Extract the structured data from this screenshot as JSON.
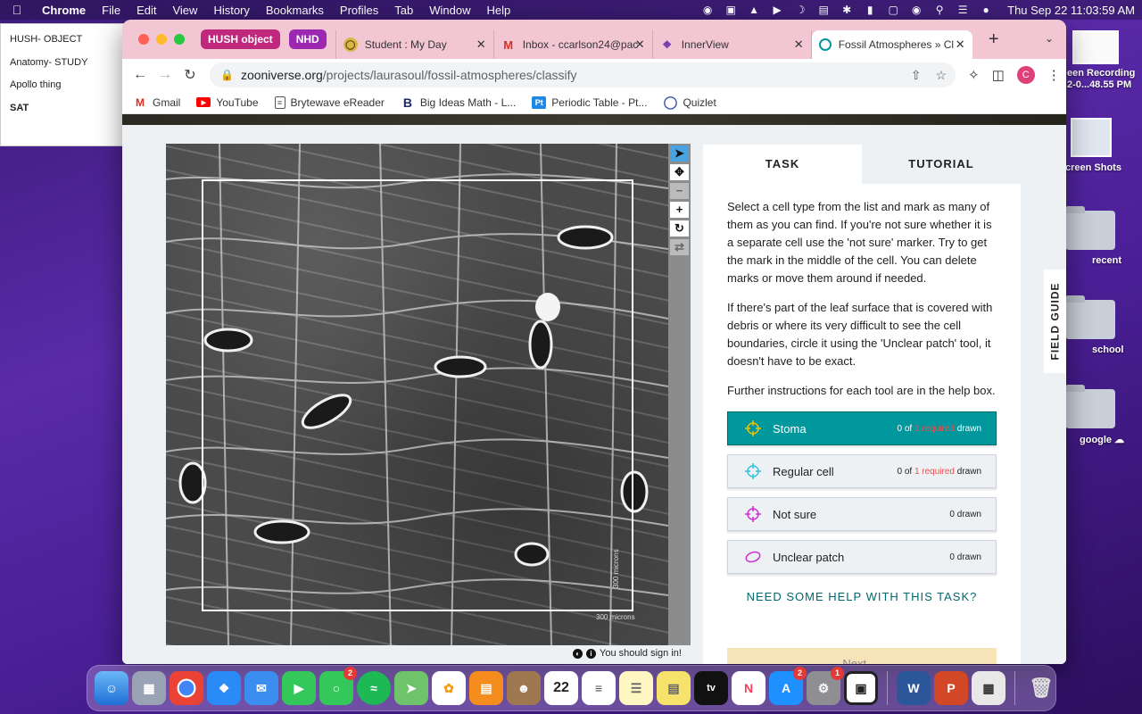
{
  "menubar": {
    "app": "Chrome",
    "items": [
      "File",
      "Edit",
      "View",
      "History",
      "Bookmarks",
      "Profiles",
      "Tab",
      "Window",
      "Help"
    ],
    "clock": "Thu Sep 22  11:03:59 AM"
  },
  "sticky": {
    "items": [
      "HUSH- OBJECT",
      "Anatomy- STUDY",
      "Apollo thing",
      "SAT"
    ]
  },
  "desktop": {
    "screen_recording": "een Recording\n2-0...48.55 PM",
    "screen_shots": "creen Shots",
    "recent": "recent",
    "school": "school",
    "google": "google"
  },
  "browser": {
    "tab_groups": [
      {
        "label": "HUSH object",
        "color": "#c0287e"
      },
      {
        "label": "NHD",
        "color": "#9c27b0"
      }
    ],
    "tabs": [
      {
        "label": "Student : My Day",
        "icon": "student-icon"
      },
      {
        "label": "Inbox - ccarlson24@pac",
        "icon": "gmail-icon"
      },
      {
        "label": "InnerView",
        "icon": "innerview-icon"
      },
      {
        "label": "Fossil Atmospheres » Cl",
        "icon": "zooniverse-icon"
      }
    ],
    "url_host": "zooniverse.org",
    "url_path": "/projects/laurasoul/fossil-atmospheres/classify",
    "avatar_letter": "C",
    "bookmarks": [
      "Gmail",
      "YouTube",
      "Brytewave eReader",
      "Big Ideas Math - L...",
      "Periodic Table - Pt...",
      "Quizlet"
    ]
  },
  "subject": {
    "scale_bottom": "300 microns",
    "scale_side": "300 microns"
  },
  "signin_text": "You should sign in!",
  "task": {
    "tab_task": "TASK",
    "tab_tutorial": "TUTORIAL",
    "paragraphs": [
      "Select a cell type from the list and mark as many of them as you can find. If you're not sure whether it is a separate cell use the 'not sure' marker. Try to get the mark in the middle of the cell. You can delete marks or move them around if needed.",
      "If there's part of the leaf surface that is covered with debris or where its very difficult to see the cell boundaries, circle it using the 'Unclear patch' tool, it doesn't have to be exact.",
      "Further instructions for each tool are in the help box."
    ],
    "tools": [
      {
        "label": "Stoma",
        "count_pre": "0 of ",
        "count_req": "1 required",
        "count_post": " drawn",
        "color": "#f2c200",
        "active": true
      },
      {
        "label": "Regular cell",
        "count_pre": "0 of ",
        "count_req": "1 required",
        "count_post": " drawn",
        "color": "#33c3e0",
        "active": false
      },
      {
        "label": "Not sure",
        "count_pre": "0 drawn",
        "count_req": "",
        "count_post": "",
        "color": "#d22fd2",
        "active": false
      },
      {
        "label": "Unclear patch",
        "count_pre": "0 drawn",
        "count_req": "",
        "count_post": "",
        "color": "#d22fd2",
        "active": false
      }
    ],
    "help_link": "NEED SOME HELP WITH THIS TASK?",
    "next_label": "Next →"
  },
  "field_guide": "FIELD GUIDE"
}
